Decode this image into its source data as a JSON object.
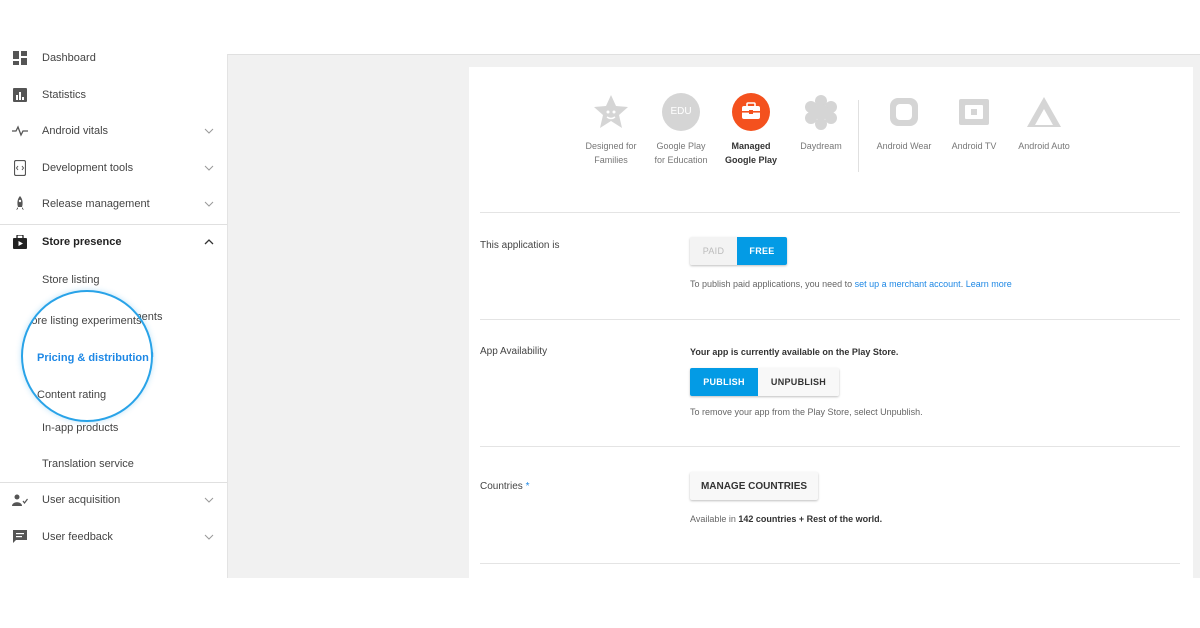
{
  "sidebar": {
    "items": [
      {
        "label": "Dashboard",
        "icon": "dashboard-icon"
      },
      {
        "label": "Statistics",
        "icon": "statistics-icon"
      },
      {
        "label": "Android vitals",
        "icon": "vitals-icon"
      },
      {
        "label": "Development tools",
        "icon": "development-tools-icon"
      },
      {
        "label": "Release management",
        "icon": "rocket-icon"
      },
      {
        "label": "Store presence",
        "icon": "store-icon"
      },
      {
        "label": "User acquisition",
        "icon": "user-acquisition-icon"
      },
      {
        "label": "User feedback",
        "icon": "feedback-icon"
      }
    ],
    "subitems": [
      "Store listing",
      "Store listing experiments",
      "Pricing & distribution",
      "Content rating",
      "In-app products",
      "Translation service"
    ]
  },
  "platforms": [
    {
      "line1": "Designed for",
      "line2": "Families",
      "icon": "families-star-icon"
    },
    {
      "line1": "Google Play",
      "line2": "for Education",
      "icon": "education-icon",
      "icon_text": "EDU"
    },
    {
      "line1": "Managed",
      "line2": "Google Play",
      "icon": "managed-briefcase-icon"
    },
    {
      "line1": "Daydream",
      "line2": "",
      "icon": "daydream-icon"
    },
    {
      "line1": "Android Wear",
      "line2": "",
      "icon": "wear-icon"
    },
    {
      "line1": "Android TV",
      "line2": "",
      "icon": "tv-icon"
    },
    {
      "line1": "Android Auto",
      "line2": "",
      "icon": "auto-icon"
    }
  ],
  "pricing": {
    "label": "This application is",
    "paid": "PAID",
    "free": "FREE",
    "note_prefix": "To publish paid applications, you need to ",
    "merchant_link": "set up a merchant account",
    "learn_more": "Learn more"
  },
  "availability": {
    "label": "App Availability",
    "status": "Your app is currently available on the Play Store.",
    "publish": "PUBLISH",
    "unpublish": "UNPUBLISH",
    "note": "To remove your app from the Play Store, select Unpublish."
  },
  "countries": {
    "label": "Countries",
    "required": "*",
    "button": "MANAGE COUNTRIES",
    "available_prefix": "Available in ",
    "available_bold": "142 countries + Rest of the world."
  },
  "colors": {
    "accent": "#039be5",
    "managed": "#f4511e",
    "highlight_ring": "#29a3e8"
  }
}
